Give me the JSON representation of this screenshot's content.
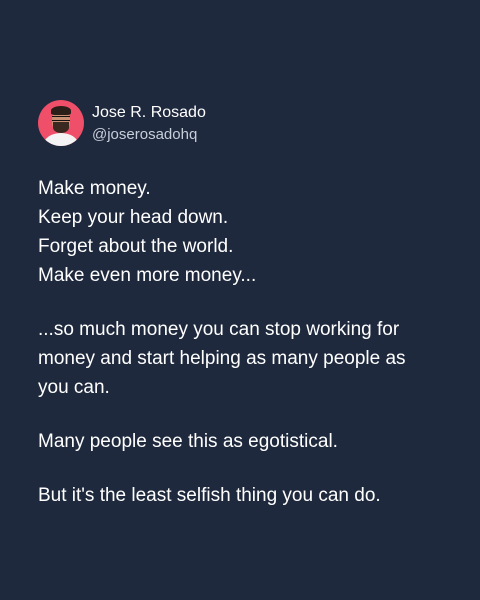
{
  "author": {
    "name": "Jose R. Rosado",
    "handle": "@joserosadohq"
  },
  "post": {
    "lines_1": [
      "Make money.",
      "Keep your head down.",
      "Forget about the world.",
      "Make even more money..."
    ],
    "lines_2": [
      "...so much money you can stop working for",
      "money and start helping as many people as",
      "you can."
    ],
    "line_3": "Many people see this as egotistical.",
    "line_4": "But it's the least selfish thing you can do."
  },
  "colors": {
    "background": "#1f293d",
    "text": "#ffffff",
    "muted_text": "#c7ced9",
    "avatar_background": "#ef4f68"
  }
}
